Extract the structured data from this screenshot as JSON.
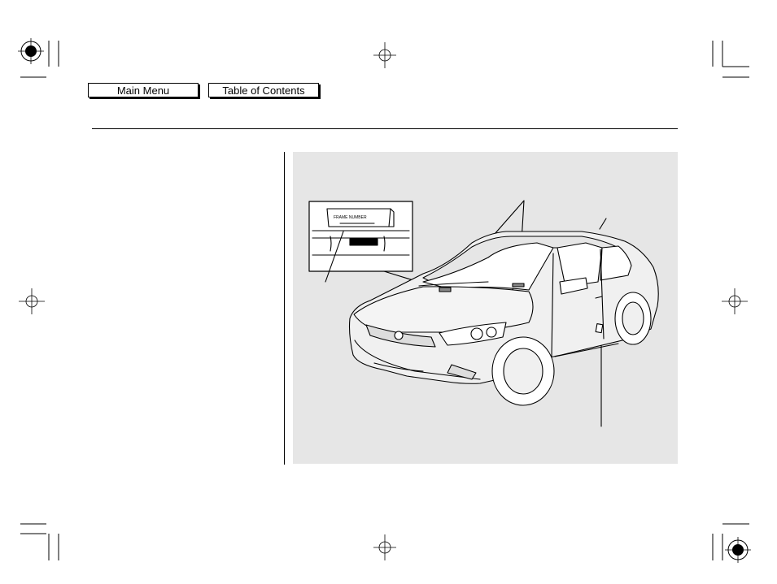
{
  "nav": {
    "main_menu": "Main Menu",
    "table_of_contents": "Table of Contents"
  },
  "figure": {
    "inset_label": "FRAME NUMBER"
  },
  "icons": [
    "registration-target-icon",
    "crosshair-icon",
    "crop-mark-icon"
  ],
  "colors": {
    "figure_background": "#e6e6e6",
    "line": "#000000"
  }
}
